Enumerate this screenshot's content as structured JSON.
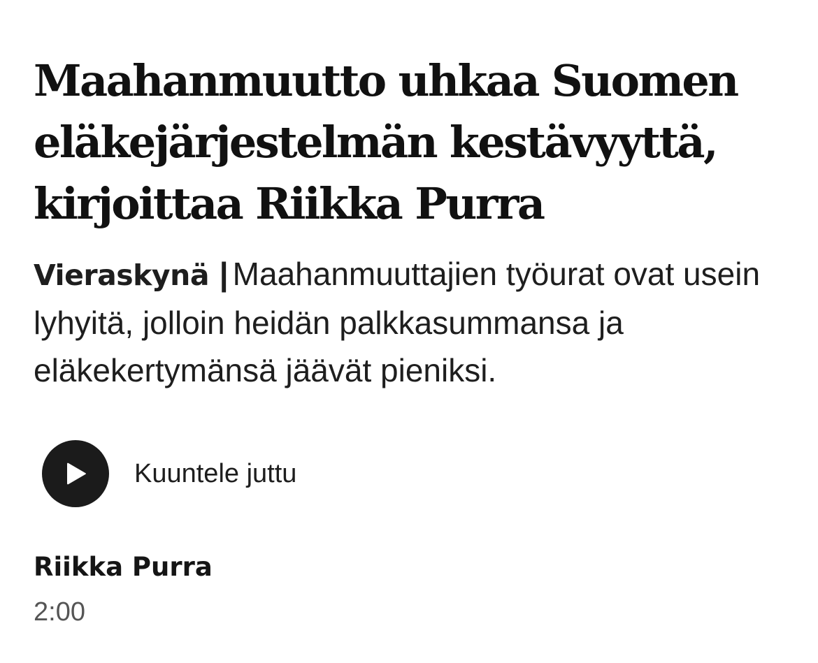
{
  "article": {
    "headline": "Maahanmuutto uhkaa Suomen eläkejärjestelmän kestävyyttä, kirjoittaa Riikka Purra",
    "kicker": "Vieraskynä",
    "separator": "|",
    "lead": "Maahanmuuttajien työurat ovat usein lyhyitä, jolloin heidän palkkasummansa ja eläkekertymänsä jäävät pieniksi."
  },
  "audio": {
    "icon": "play-icon",
    "label": "Kuuntele juttu"
  },
  "byline": {
    "author": "Riikka Purra",
    "duration": "2:00"
  }
}
